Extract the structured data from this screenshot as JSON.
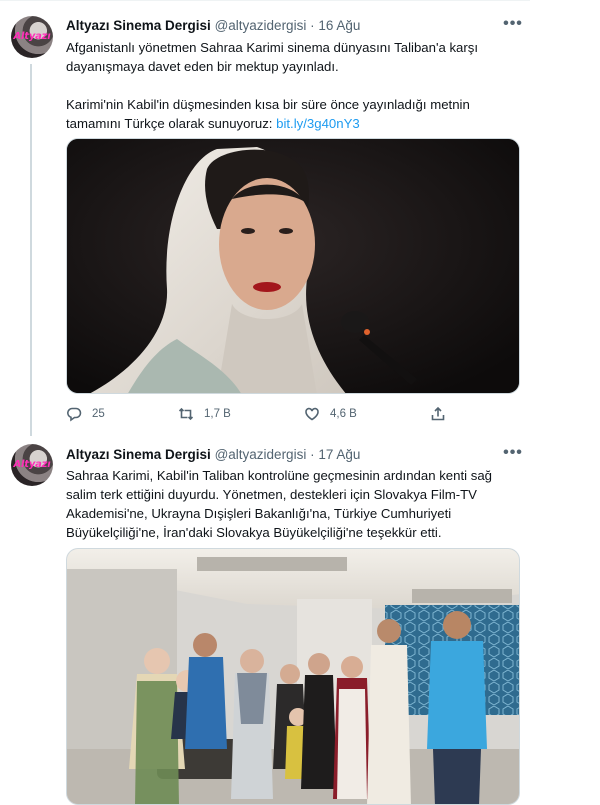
{
  "tweets": [
    {
      "avatar_logo": "Altyazı",
      "author_name": "Altyazı Sinema Dergisi",
      "handle": "@altyazidergisi",
      "separator": "·",
      "date": "16 Ağu",
      "more_label": "•••",
      "text_line1": "Afganistanlı yönetmen Sahraa Karimi sinema dünyasını Taliban'a karşı",
      "text_line2": "dayanışmaya davet eden bir mektup yayınladı.",
      "text_line3": "Karimi'nin Kabil'in düşmesinden kısa bir süre önce yayınladığı metnin",
      "text_line4_prefix": "tamamını Türkçe olarak sunuyoruz:",
      "link_text": "bit.ly/3g40nY3",
      "image_icon": "portrait-photo",
      "reply_count": "25",
      "retweet_count": "1,7 B",
      "like_count": "4,6 B"
    },
    {
      "avatar_logo": "Altyazı",
      "author_name": "Altyazı Sinema Dergisi",
      "handle": "@altyazidergisi",
      "separator": "·",
      "date": "17 Ağu",
      "more_label": "•••",
      "text_line1": "Sahraa Karimi, Kabil'in Taliban kontrolüne geçmesinin ardından kenti sağ",
      "text_line2": "salim terk ettiğini duyurdu. Yönetmen, destekleri için Slovakya Film-TV",
      "text_line3": "Akademisi'ne, Ukrayna Dışişleri Bakanlığı'na, Türkiye Cumhuriyeti",
      "text_line4": "Büyükelçiliği'ne, İran'daki Slovakya Büyükelçiliği'ne teşekkür etti.",
      "image_icon": "group-photo"
    }
  ],
  "colors": {
    "link": "#1d9bf0",
    "secondary_text": "#536471",
    "border": "#cfd9de",
    "logo_pink": "#ff2fb8"
  }
}
